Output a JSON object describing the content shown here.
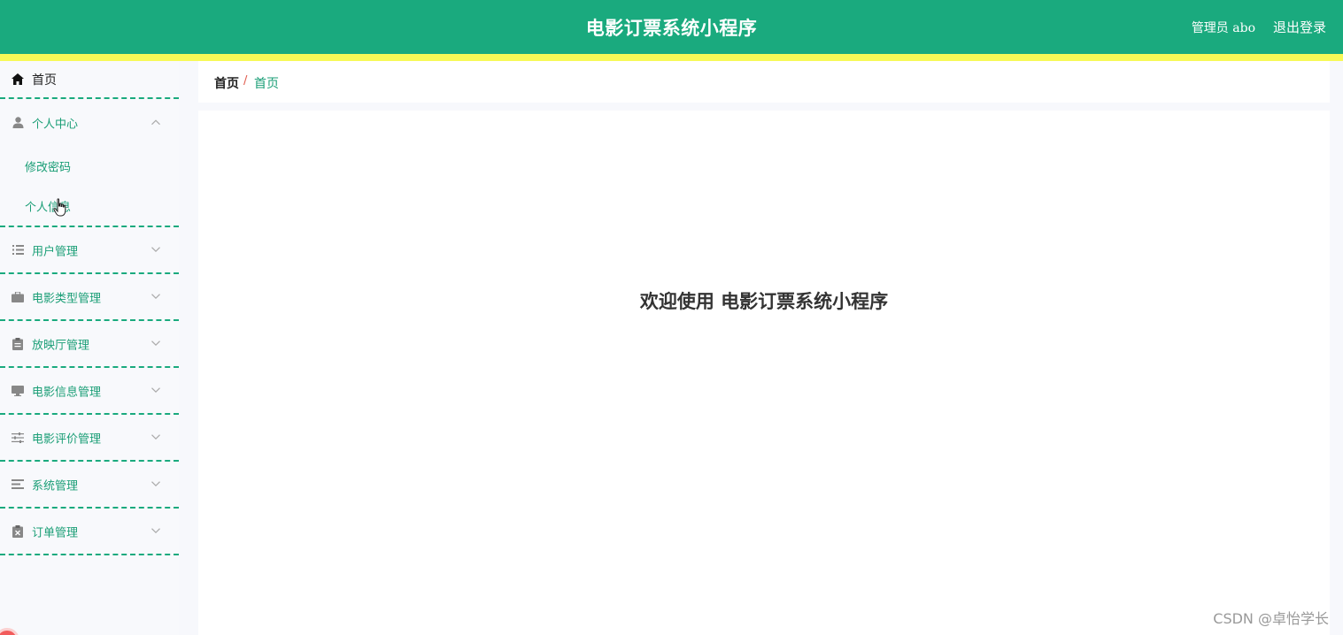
{
  "header": {
    "title": "电影订票系统小程序",
    "user": "管理员 abo",
    "logout": "退出登录"
  },
  "sidebar": {
    "home": {
      "label": "首页",
      "icon": "home-icon"
    },
    "personal": {
      "label": "个人中心",
      "icon": "user-icon",
      "expanded": true,
      "items": [
        {
          "label": "修改密码"
        },
        {
          "label": "个人信息"
        }
      ]
    },
    "items": [
      {
        "label": "用户管理",
        "icon": "list-icon"
      },
      {
        "label": "电影类型管理",
        "icon": "briefcase-icon"
      },
      {
        "label": "放映厅管理",
        "icon": "clipboard-icon"
      },
      {
        "label": "电影信息管理",
        "icon": "monitor-icon"
      },
      {
        "label": "电影评价管理",
        "icon": "sliders-icon"
      },
      {
        "label": "系统管理",
        "icon": "menu-icon"
      },
      {
        "label": "订单管理",
        "icon": "clipboard-x-icon"
      }
    ]
  },
  "breadcrumb": {
    "root": "首页",
    "separator": "/",
    "current": "首页"
  },
  "content": {
    "welcome": "欢迎使用 电影订票系统小程序"
  },
  "watermark": "CSDN @卓怡学长",
  "colors": {
    "primary": "#1aaa7e",
    "accent_bar": "#f7f957",
    "menu_text": "#1a9e76",
    "separator": "#e0584a"
  }
}
